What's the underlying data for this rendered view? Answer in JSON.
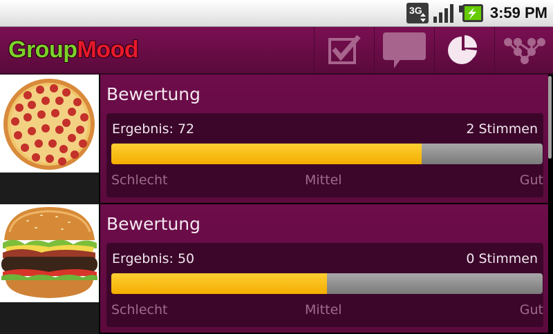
{
  "status_bar": {
    "time": "3:59 PM",
    "network_label": "3G",
    "icons": [
      "3g-data-icon",
      "signal-strength-icon",
      "battery-charging-icon"
    ]
  },
  "app": {
    "logo_part1": "Group",
    "logo_part2": "Mood",
    "actions": [
      "checkbox-icon",
      "chat-bubble-icon",
      "pie-chart-icon",
      "network-icon"
    ]
  },
  "items": [
    {
      "image": "pizza",
      "title": "Bewertung",
      "result_label": "Ergebnis: 72",
      "votes_label": "2 Stimmen",
      "progress_fraction": 0.72,
      "scale_low": "Schlecht",
      "scale_mid": "Mittel",
      "scale_high": "Gut"
    },
    {
      "image": "burger",
      "title": "Bewertung",
      "result_label": "Ergebnis: 50",
      "votes_label": "0 Stimmen",
      "progress_fraction": 0.5,
      "scale_low": "Schlecht",
      "scale_mid": "Mittel",
      "scale_high": "Gut"
    }
  ],
  "colors": {
    "accent": "#6e0d4b",
    "progress": "#ffc000"
  }
}
